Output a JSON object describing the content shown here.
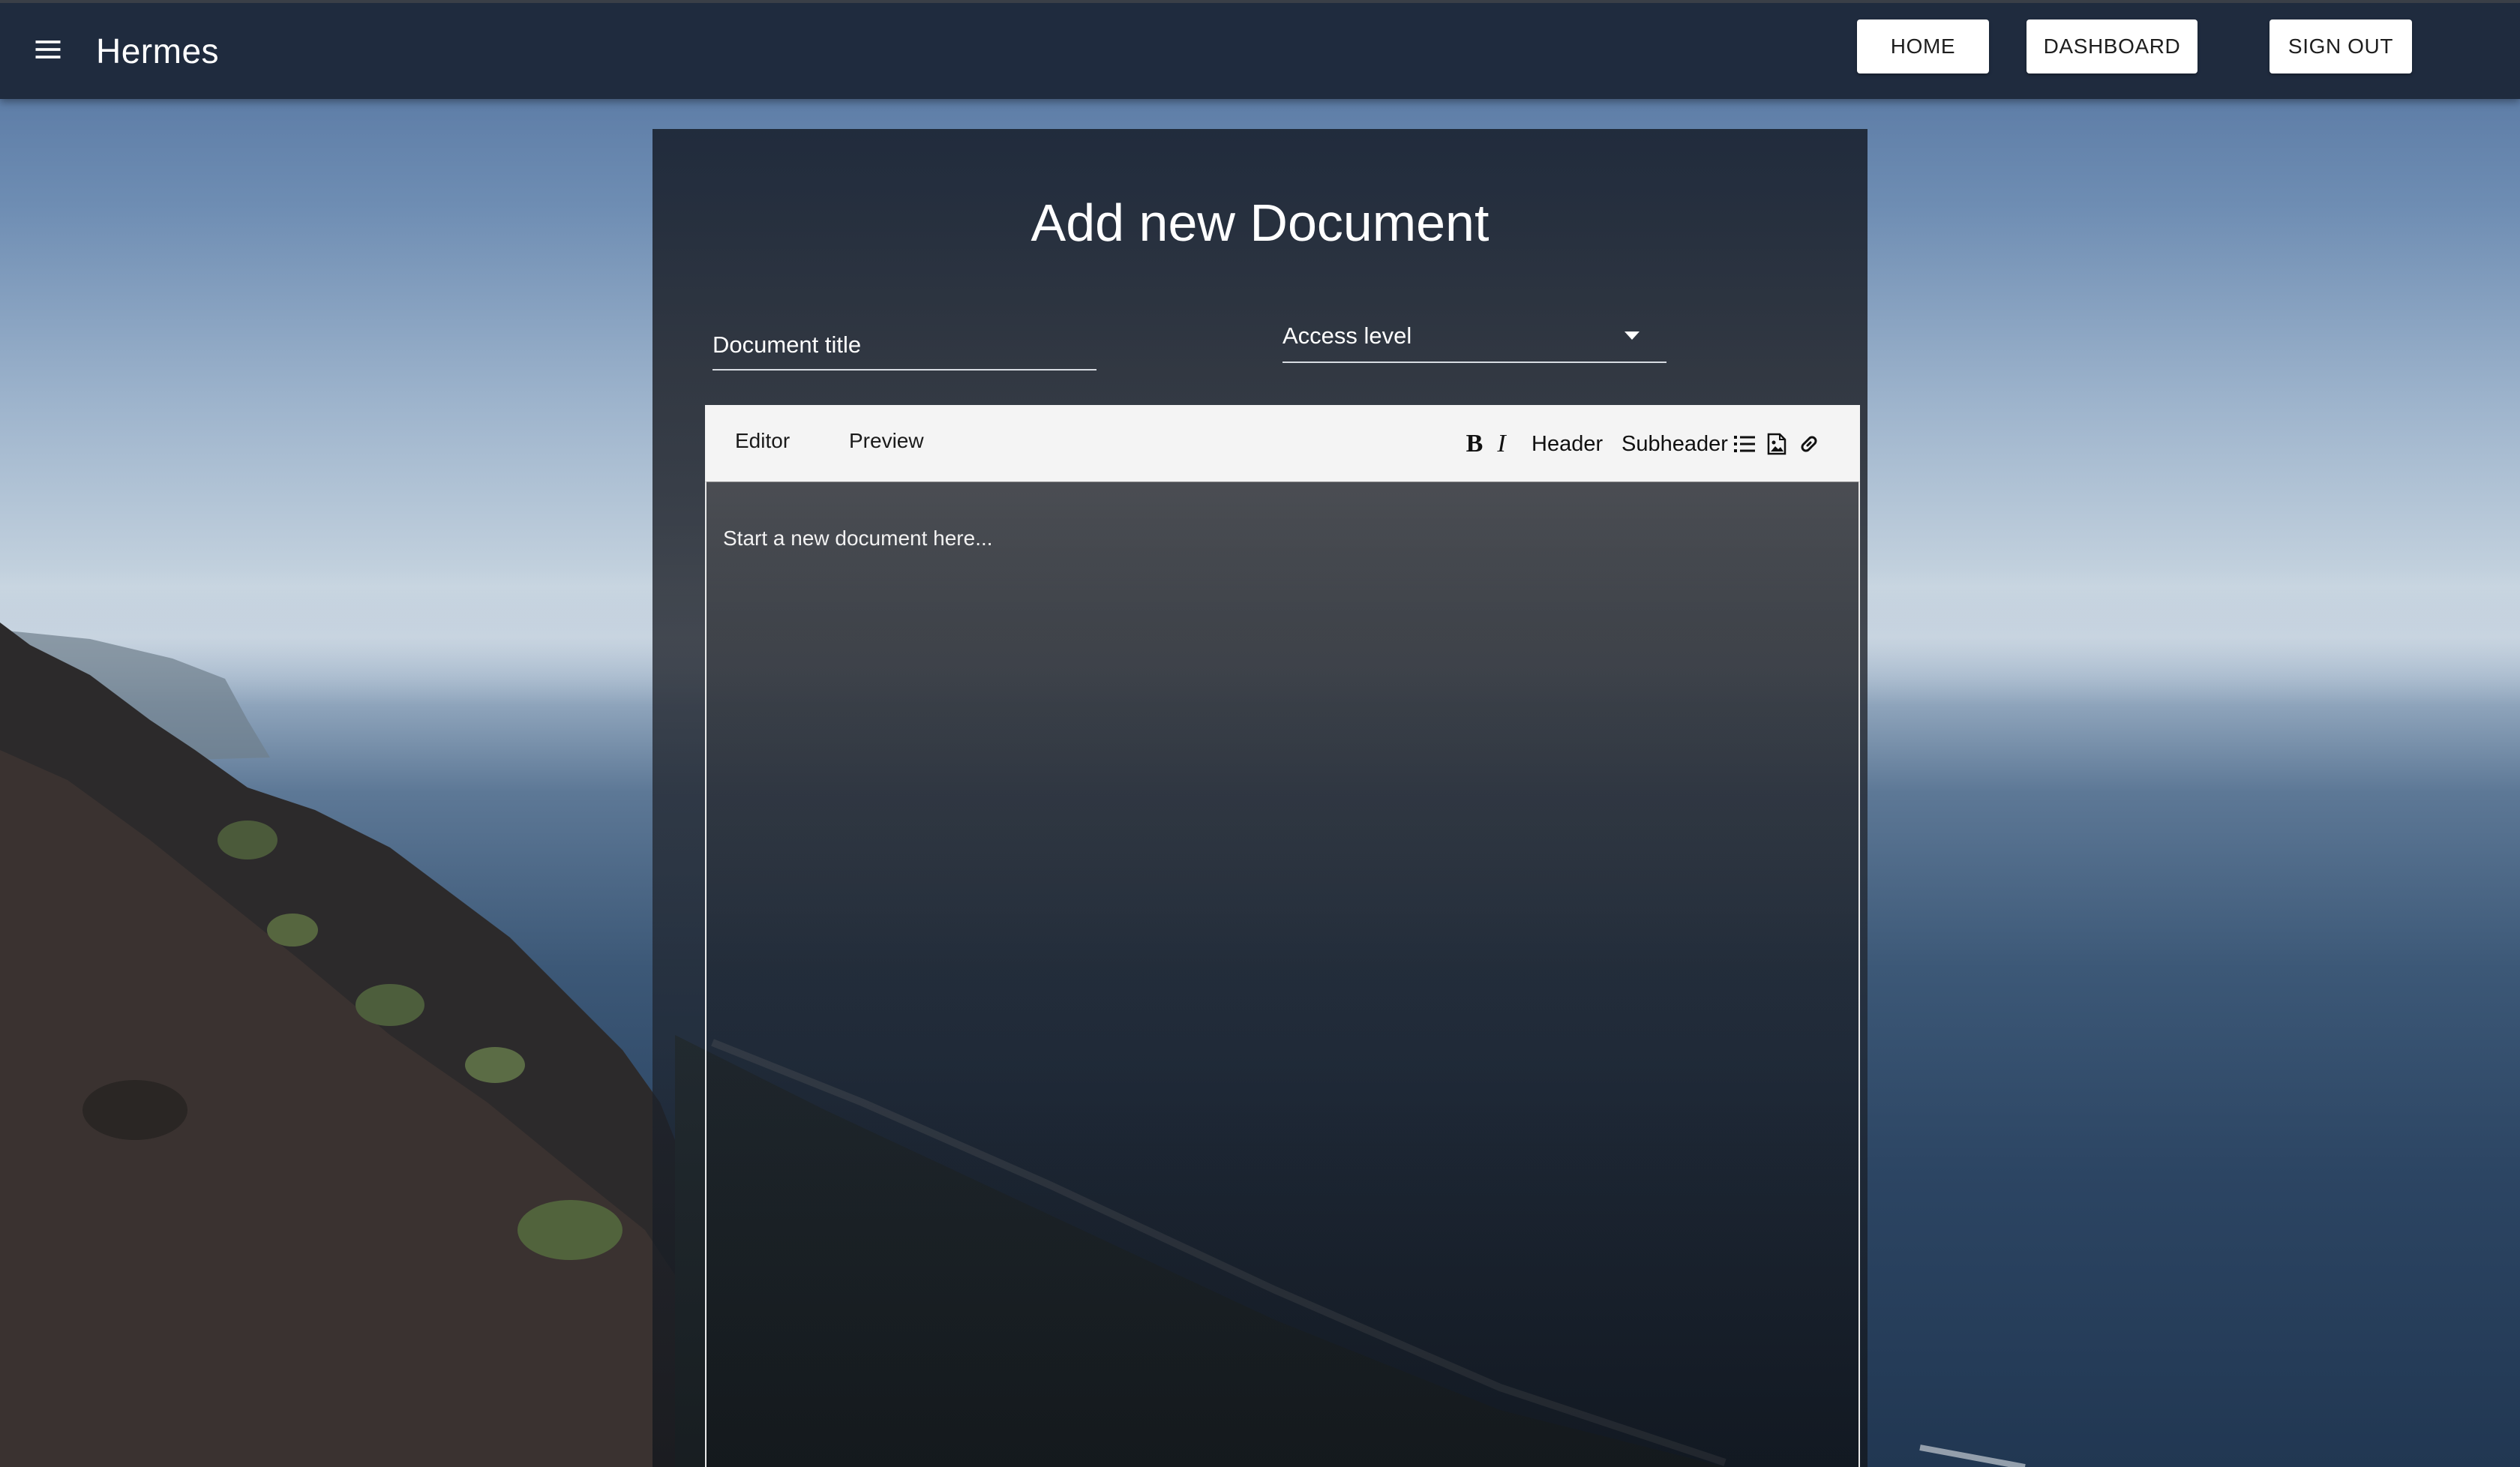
{
  "app": {
    "brand": "Hermes"
  },
  "nav": {
    "home_label": "HOME",
    "dashboard_label": "DASHBOARD",
    "signout_label": "SIGN OUT"
  },
  "form": {
    "title": "Add new Document",
    "document_title_placeholder": "Document title",
    "document_title_value": "",
    "access_level_label": "Access level"
  },
  "editor": {
    "tabs": [
      {
        "label": "Editor"
      },
      {
        "label": "Preview"
      }
    ],
    "toolbar": {
      "bold_label": "B",
      "italic_label": "I",
      "header_label": "Header",
      "subheader_label": "Subheader",
      "icons": [
        "list-icon",
        "image-icon",
        "link-icon"
      ]
    },
    "placeholder": "Start a new document here..."
  },
  "colors": {
    "appbar": "#1f2b3e",
    "card": "#2a2f38",
    "button_bg": "#ffffff",
    "text": "#ffffff",
    "toolbar_bg": "#f4f4f4"
  }
}
